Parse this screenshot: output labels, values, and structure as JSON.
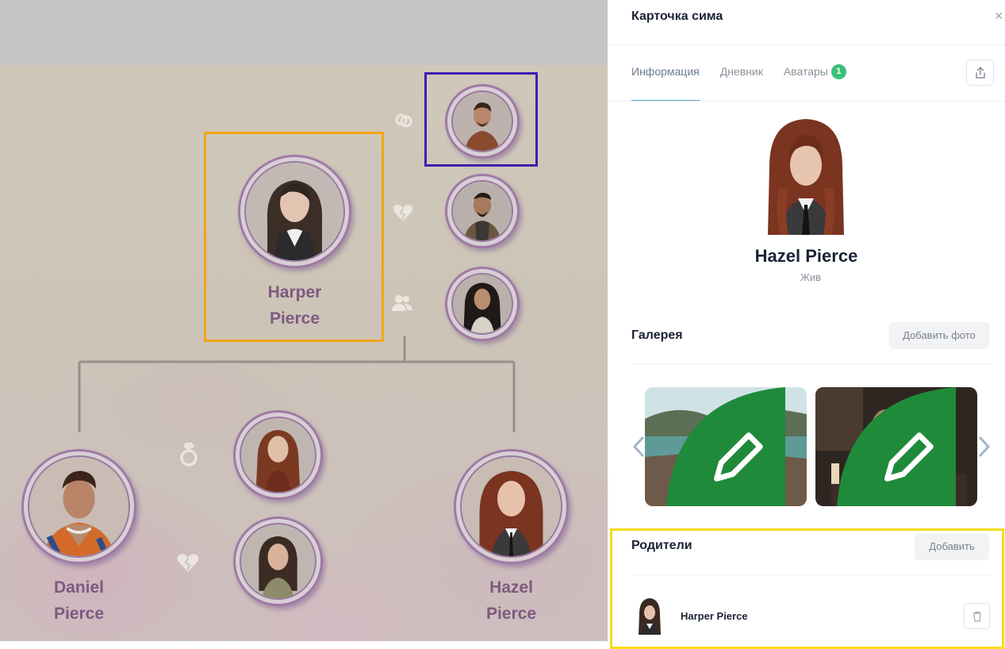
{
  "tree": {
    "nodes": {
      "harper": {
        "first": "Harper",
        "last": "Pierce"
      },
      "daniel": {
        "first": "Daniel",
        "last": "Pierce"
      },
      "hazel": {
        "first": "Hazel",
        "last": "Pierce"
      }
    },
    "relationship_icons": [
      "rings-icon",
      "broken-heart-icon",
      "people-icon",
      "ring-icon",
      "broken-heart-icon"
    ],
    "highlight_colors": {
      "selected": "#f2a516",
      "partner": "#3c1fb0",
      "parents": "#f7dc16"
    }
  },
  "panel": {
    "title": "Карточка сима",
    "tabs": [
      {
        "label": "Информация",
        "active": true
      },
      {
        "label": "Дневник",
        "active": false
      },
      {
        "label": "Аватары",
        "active": false,
        "badge": "1"
      }
    ],
    "profile": {
      "name": "Hazel Pierce",
      "status": "Жив"
    },
    "gallery": {
      "title": "Галерея",
      "add_label": "Добавить фото"
    },
    "parents": {
      "title": "Родители",
      "add_label": "Добавить",
      "items": [
        {
          "name": "Harper Pierce"
        }
      ]
    }
  },
  "colors": {
    "accent_tab": "#5aa3c9",
    "badge": "#3bc07a",
    "edit_green": "#1f8a3a",
    "node_text": "#7d5a80"
  }
}
